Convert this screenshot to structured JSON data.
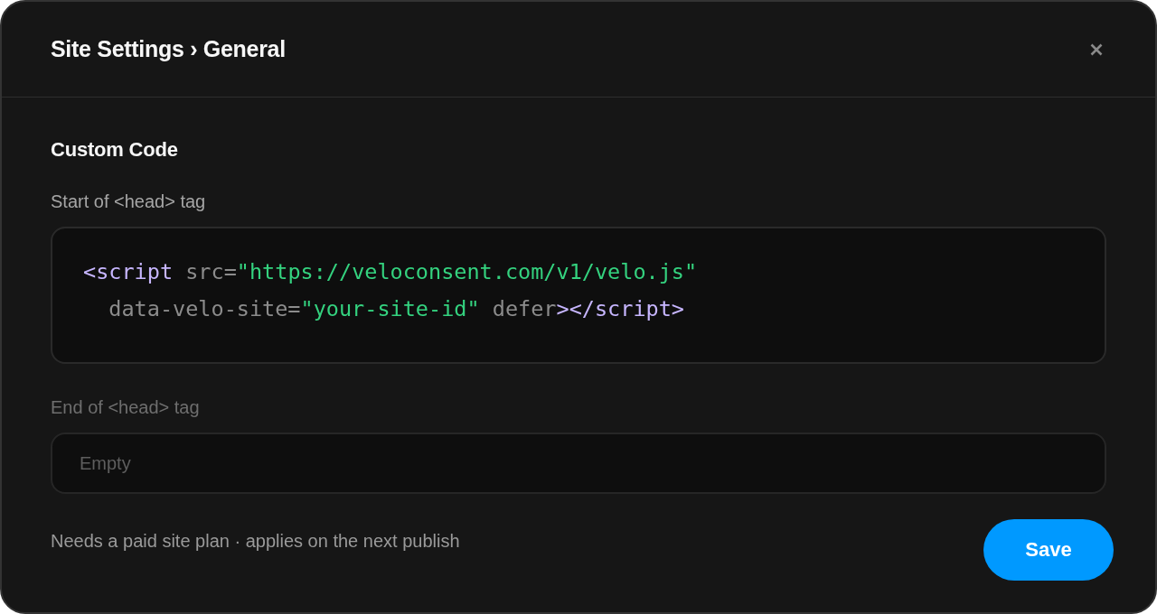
{
  "dialog": {
    "title": "Site Settings › General"
  },
  "section": {
    "title": "Custom Code"
  },
  "fields": [
    {
      "kind": "code",
      "label": "Start of <head> tag",
      "disabled": false,
      "lines": [
        [
          {
            "kind": "tag",
            "text": "<script"
          },
          {
            "kind": "attr",
            "text": " src="
          },
          {
            "kind": "string",
            "text": "\"https://veloconsent.com/v1/velo.js\""
          }
        ],
        [
          {
            "kind": "attr",
            "text": "  data-velo-site="
          },
          {
            "kind": "string",
            "text": "\"your-site-id\""
          },
          {
            "kind": "attr",
            "text": " defer"
          },
          {
            "kind": "tag",
            "text": "></script>"
          }
        ]
      ]
    },
    {
      "kind": "text",
      "label": "End of <head> tag",
      "disabled": true,
      "placeholder": "Empty"
    }
  ],
  "footer": {
    "note": "Needs a paid site plan · applies on the next publish",
    "buttons": [
      {
        "kind": "primary",
        "label": "Save"
      }
    ]
  }
}
